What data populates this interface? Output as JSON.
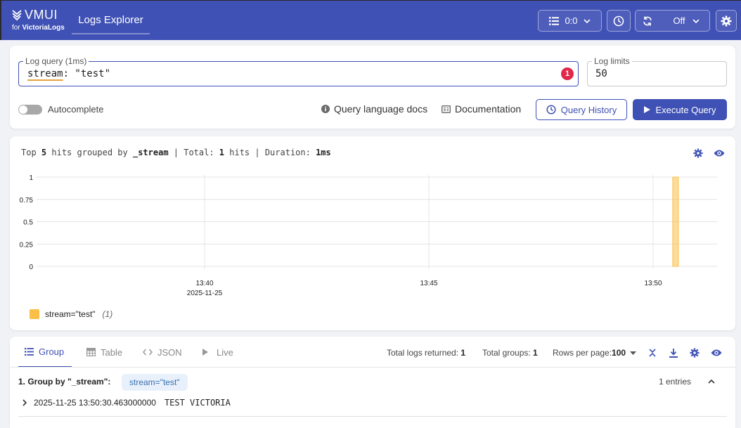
{
  "header": {
    "logo_main": "VM",
    "logo_ui": "UI",
    "logo_for": "for ",
    "logo_product": "VictoriaLogs",
    "tab_label": "Logs Explorer",
    "tenant_value": "0:0",
    "refresh_value": "Off"
  },
  "query": {
    "label": "Log query (1ms)",
    "keyword": "stream",
    "rest": ": \"test\"",
    "error_count": "1",
    "limits_label": "Log limits",
    "limits_value": "50",
    "autocomplete_label": "Autocomplete",
    "autocomplete_on": false,
    "docs_link": "Query language docs",
    "documentation_link": "Documentation",
    "history_button": "Query History",
    "execute_button": "Execute Query"
  },
  "summary": {
    "t1": "Top ",
    "top_n": "5",
    "t2": " hits grouped by ",
    "group_field": "_stream",
    "t3": " | Total: ",
    "total": "1",
    "t4": " hits | Duration: ",
    "duration": "1ms"
  },
  "chart_data": {
    "type": "bar",
    "y_ticks": [
      "1",
      "0.75",
      "0.5",
      "0.25",
      "0"
    ],
    "x_ticks": [
      "13:40",
      "13:45",
      "13:50"
    ],
    "x_date_label": "2025-11-25",
    "ylim": [
      0,
      1
    ],
    "grid": true,
    "series": [
      {
        "name": "stream=\"test\"",
        "time": "13:50:30",
        "value": 1,
        "color": "#fbbf47"
      }
    ],
    "legend": {
      "label": "stream=\"test\"",
      "count": "(1)",
      "position": "bottom-left"
    }
  },
  "results": {
    "tabs": [
      "Group",
      "Table",
      "JSON",
      "Live"
    ],
    "total_logs_label": "Total logs returned: ",
    "total_logs": "1",
    "total_groups_label": "Total groups: ",
    "total_groups": "1",
    "rows_per_page_label": "Rows per page: ",
    "rows_per_page": "100",
    "group_title": "1. Group by \"_stream\":",
    "group_stream": "stream=\"test\"",
    "group_entries": "1 entries",
    "log_time": "2025-11-25 13:50:30.463000000",
    "log_message": "TEST VICTORIA"
  },
  "colors": {
    "accent": "#3f51b5",
    "bar": "#fbbf47",
    "error": "#e0284b"
  }
}
